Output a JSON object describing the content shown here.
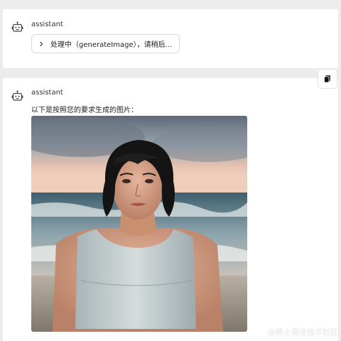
{
  "messages": [
    {
      "role": "assistant",
      "tool_call": {
        "label": "处理中（generateImage），请稍后..."
      }
    },
    {
      "role": "assistant",
      "text": "以下是按照您的要求生成的图片：",
      "image": {
        "alt": "generated-portrait",
        "description_icon": "image"
      }
    }
  ],
  "copy_button": {
    "icon": "copy-icon"
  },
  "watermark": "@稀土掘金技术社区",
  "colors": {
    "page_bg": "#ececec",
    "card_bg": "#ffffff",
    "border": "#d9d9d9"
  }
}
